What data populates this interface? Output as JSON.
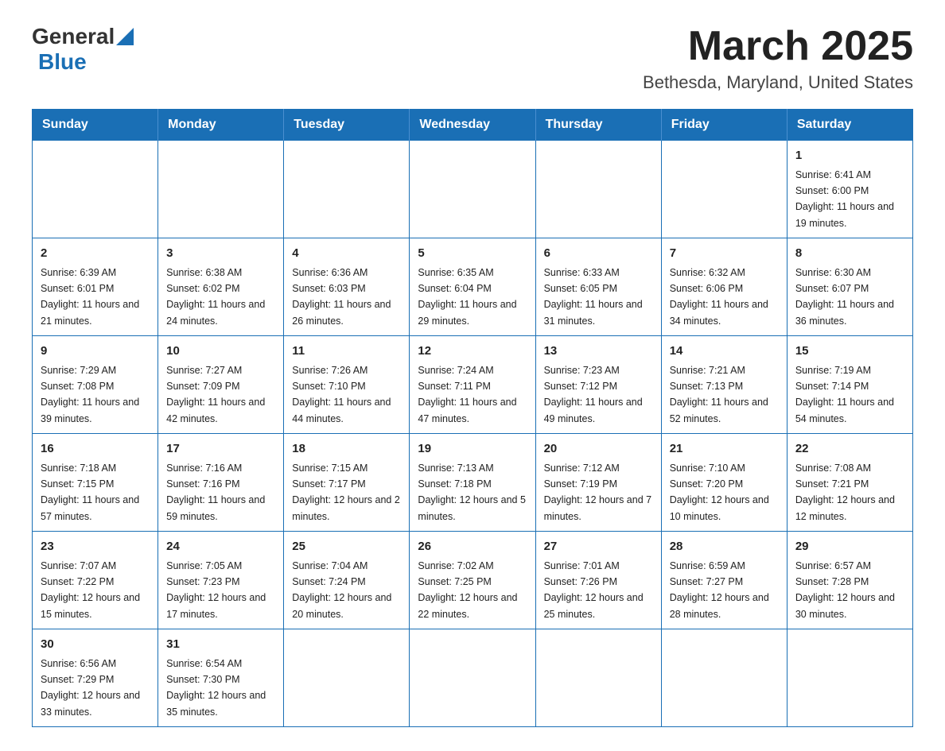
{
  "header": {
    "logo": {
      "general": "General",
      "blue": "Blue"
    },
    "title": "March 2025",
    "location": "Bethesda, Maryland, United States"
  },
  "days_of_week": [
    "Sunday",
    "Monday",
    "Tuesday",
    "Wednesday",
    "Thursday",
    "Friday",
    "Saturday"
  ],
  "weeks": [
    [
      {
        "day": "",
        "info": ""
      },
      {
        "day": "",
        "info": ""
      },
      {
        "day": "",
        "info": ""
      },
      {
        "day": "",
        "info": ""
      },
      {
        "day": "",
        "info": ""
      },
      {
        "day": "",
        "info": ""
      },
      {
        "day": "1",
        "info": "Sunrise: 6:41 AM\nSunset: 6:00 PM\nDaylight: 11 hours and 19 minutes."
      }
    ],
    [
      {
        "day": "2",
        "info": "Sunrise: 6:39 AM\nSunset: 6:01 PM\nDaylight: 11 hours and 21 minutes."
      },
      {
        "day": "3",
        "info": "Sunrise: 6:38 AM\nSunset: 6:02 PM\nDaylight: 11 hours and 24 minutes."
      },
      {
        "day": "4",
        "info": "Sunrise: 6:36 AM\nSunset: 6:03 PM\nDaylight: 11 hours and 26 minutes."
      },
      {
        "day": "5",
        "info": "Sunrise: 6:35 AM\nSunset: 6:04 PM\nDaylight: 11 hours and 29 minutes."
      },
      {
        "day": "6",
        "info": "Sunrise: 6:33 AM\nSunset: 6:05 PM\nDaylight: 11 hours and 31 minutes."
      },
      {
        "day": "7",
        "info": "Sunrise: 6:32 AM\nSunset: 6:06 PM\nDaylight: 11 hours and 34 minutes."
      },
      {
        "day": "8",
        "info": "Sunrise: 6:30 AM\nSunset: 6:07 PM\nDaylight: 11 hours and 36 minutes."
      }
    ],
    [
      {
        "day": "9",
        "info": "Sunrise: 7:29 AM\nSunset: 7:08 PM\nDaylight: 11 hours and 39 minutes."
      },
      {
        "day": "10",
        "info": "Sunrise: 7:27 AM\nSunset: 7:09 PM\nDaylight: 11 hours and 42 minutes."
      },
      {
        "day": "11",
        "info": "Sunrise: 7:26 AM\nSunset: 7:10 PM\nDaylight: 11 hours and 44 minutes."
      },
      {
        "day": "12",
        "info": "Sunrise: 7:24 AM\nSunset: 7:11 PM\nDaylight: 11 hours and 47 minutes."
      },
      {
        "day": "13",
        "info": "Sunrise: 7:23 AM\nSunset: 7:12 PM\nDaylight: 11 hours and 49 minutes."
      },
      {
        "day": "14",
        "info": "Sunrise: 7:21 AM\nSunset: 7:13 PM\nDaylight: 11 hours and 52 minutes."
      },
      {
        "day": "15",
        "info": "Sunrise: 7:19 AM\nSunset: 7:14 PM\nDaylight: 11 hours and 54 minutes."
      }
    ],
    [
      {
        "day": "16",
        "info": "Sunrise: 7:18 AM\nSunset: 7:15 PM\nDaylight: 11 hours and 57 minutes."
      },
      {
        "day": "17",
        "info": "Sunrise: 7:16 AM\nSunset: 7:16 PM\nDaylight: 11 hours and 59 minutes."
      },
      {
        "day": "18",
        "info": "Sunrise: 7:15 AM\nSunset: 7:17 PM\nDaylight: 12 hours and 2 minutes."
      },
      {
        "day": "19",
        "info": "Sunrise: 7:13 AM\nSunset: 7:18 PM\nDaylight: 12 hours and 5 minutes."
      },
      {
        "day": "20",
        "info": "Sunrise: 7:12 AM\nSunset: 7:19 PM\nDaylight: 12 hours and 7 minutes."
      },
      {
        "day": "21",
        "info": "Sunrise: 7:10 AM\nSunset: 7:20 PM\nDaylight: 12 hours and 10 minutes."
      },
      {
        "day": "22",
        "info": "Sunrise: 7:08 AM\nSunset: 7:21 PM\nDaylight: 12 hours and 12 minutes."
      }
    ],
    [
      {
        "day": "23",
        "info": "Sunrise: 7:07 AM\nSunset: 7:22 PM\nDaylight: 12 hours and 15 minutes."
      },
      {
        "day": "24",
        "info": "Sunrise: 7:05 AM\nSunset: 7:23 PM\nDaylight: 12 hours and 17 minutes."
      },
      {
        "day": "25",
        "info": "Sunrise: 7:04 AM\nSunset: 7:24 PM\nDaylight: 12 hours and 20 minutes."
      },
      {
        "day": "26",
        "info": "Sunrise: 7:02 AM\nSunset: 7:25 PM\nDaylight: 12 hours and 22 minutes."
      },
      {
        "day": "27",
        "info": "Sunrise: 7:01 AM\nSunset: 7:26 PM\nDaylight: 12 hours and 25 minutes."
      },
      {
        "day": "28",
        "info": "Sunrise: 6:59 AM\nSunset: 7:27 PM\nDaylight: 12 hours and 28 minutes."
      },
      {
        "day": "29",
        "info": "Sunrise: 6:57 AM\nSunset: 7:28 PM\nDaylight: 12 hours and 30 minutes."
      }
    ],
    [
      {
        "day": "30",
        "info": "Sunrise: 6:56 AM\nSunset: 7:29 PM\nDaylight: 12 hours and 33 minutes."
      },
      {
        "day": "31",
        "info": "Sunrise: 6:54 AM\nSunset: 7:30 PM\nDaylight: 12 hours and 35 minutes."
      },
      {
        "day": "",
        "info": ""
      },
      {
        "day": "",
        "info": ""
      },
      {
        "day": "",
        "info": ""
      },
      {
        "day": "",
        "info": ""
      },
      {
        "day": "",
        "info": ""
      }
    ]
  ]
}
